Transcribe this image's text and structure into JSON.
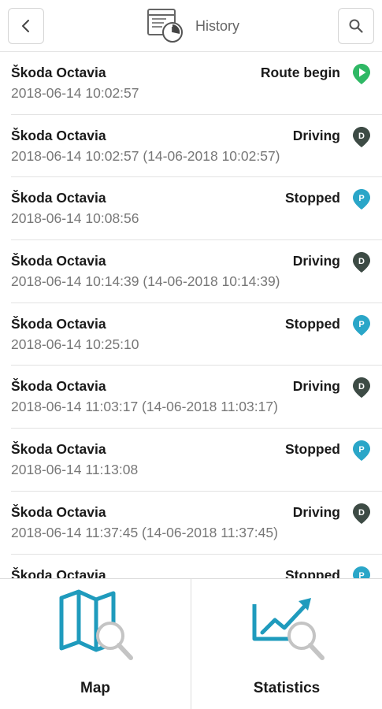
{
  "header": {
    "title": "History",
    "back_icon": "chevron-left-icon",
    "search_icon": "search-icon",
    "title_icon": "history-clock-icon"
  },
  "events": [
    {
      "vehicle": "Škoda Octavia",
      "status": "Route begin",
      "time": "2018-06-14 10:02:57",
      "icon": "route-begin-pin-icon",
      "color": "#2fb865"
    },
    {
      "vehicle": "Škoda Octavia",
      "status": "Driving",
      "time": "2018-06-14 10:02:57 (14-06-2018 10:02:57)",
      "icon": "driving-pin-icon",
      "color": "#3d4b45"
    },
    {
      "vehicle": "Škoda Octavia",
      "status": "Stopped",
      "time": "2018-06-14 10:08:56",
      "icon": "stopped-pin-icon",
      "color": "#2aa6c8"
    },
    {
      "vehicle": "Škoda Octavia",
      "status": "Driving",
      "time": "2018-06-14 10:14:39 (14-06-2018 10:14:39)",
      "icon": "driving-pin-icon",
      "color": "#3d4b45"
    },
    {
      "vehicle": "Škoda Octavia",
      "status": "Stopped",
      "time": "2018-06-14 10:25:10",
      "icon": "stopped-pin-icon",
      "color": "#2aa6c8"
    },
    {
      "vehicle": "Škoda Octavia",
      "status": "Driving",
      "time": "2018-06-14 11:03:17 (14-06-2018 11:03:17)",
      "icon": "driving-pin-icon",
      "color": "#3d4b45"
    },
    {
      "vehicle": "Škoda Octavia",
      "status": "Stopped",
      "time": "2018-06-14 11:13:08",
      "icon": "stopped-pin-icon",
      "color": "#2aa6c8"
    },
    {
      "vehicle": "Škoda Octavia",
      "status": "Driving",
      "time": "2018-06-14 11:37:45 (14-06-2018 11:37:45)",
      "icon": "driving-pin-icon",
      "color": "#3d4b45"
    },
    {
      "vehicle": "Škoda Octavia",
      "status": "Stopped",
      "time": "",
      "icon": "stopped-pin-icon",
      "color": "#2aa6c8"
    }
  ],
  "bottom_nav": {
    "map_label": "Map",
    "map_icon": "map-search-icon",
    "statistics_label": "Statistics",
    "statistics_icon": "chart-search-icon"
  },
  "colors": {
    "accent": "#1f9bbd",
    "route_begin": "#2fb865",
    "driving": "#3d4b45",
    "stopped": "#2aa6c8"
  }
}
